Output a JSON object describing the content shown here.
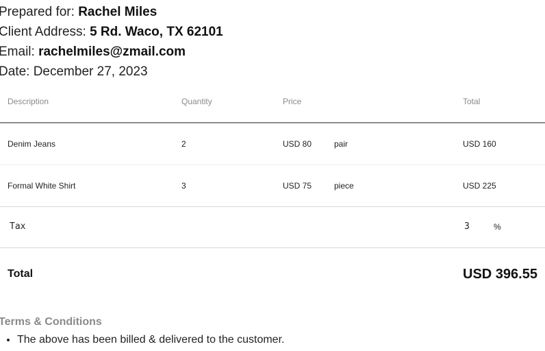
{
  "client": {
    "prepared_for_label": "Prepared for:",
    "prepared_for_value": "Rachel Miles",
    "address_label": "Client Address:",
    "address_value": "5 Rd. Waco, TX 62101",
    "email_label": "Email:",
    "email_value": "rachelmiles@zmail.com",
    "date_label": "Date:",
    "date_value": "December 27, 2023"
  },
  "table": {
    "headers": [
      "Description",
      "Quantity",
      "Price",
      "Total"
    ],
    "rows": [
      {
        "description": "Denim Jeans",
        "quantity": "2",
        "price": "USD 80",
        "unit": "pair",
        "total": "USD 160"
      },
      {
        "description": "Formal White Shirt",
        "quantity": "3",
        "price": "USD 75",
        "unit": "piece",
        "total": "USD 225"
      }
    ]
  },
  "tax": {
    "label": "Tax",
    "value": "3",
    "unit": "%"
  },
  "total": {
    "label": "Total",
    "value": "USD 396.55"
  },
  "terms": {
    "title": "Terms & Conditions",
    "items": [
      "The above has been billed & delivered to the customer."
    ]
  }
}
